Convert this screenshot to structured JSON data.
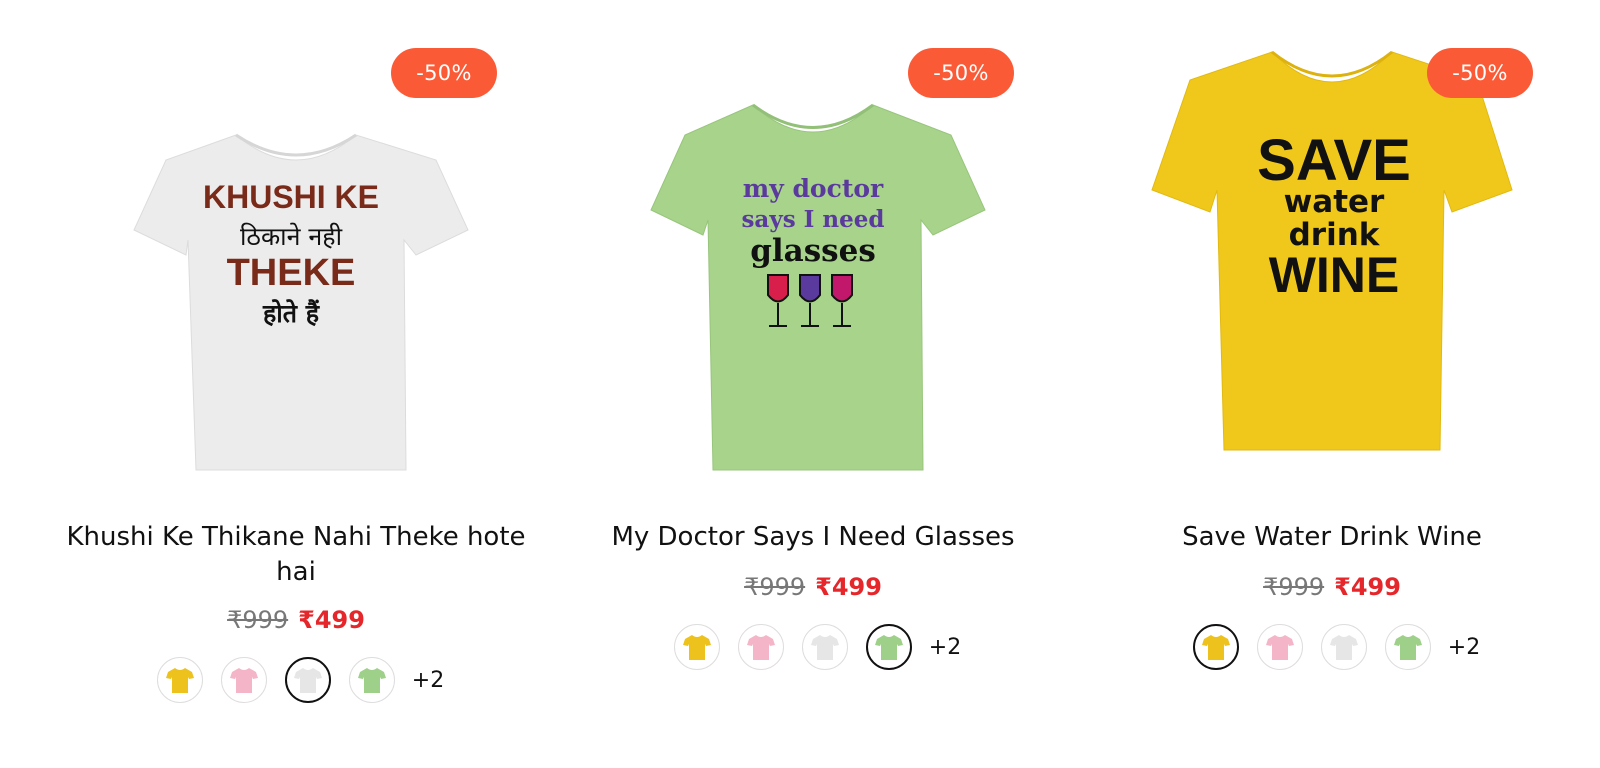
{
  "products": [
    {
      "title": "Khushi Ke Thikane Nahi Theke hote hai",
      "badge": "-50%",
      "old_price": "₹999",
      "new_price": "₹499",
      "shirt_color": "#ececec",
      "print_lines": [
        "KHUSHI KE",
        "ठिकाने नही",
        "THEKE",
        "होते हैं"
      ],
      "swatches": [
        "yellow",
        "pink",
        "white",
        "green"
      ],
      "selected_swatch": "white",
      "more_colors": "+2"
    },
    {
      "title": "My Doctor Says I Need Glasses",
      "badge": "-50%",
      "old_price": "₹999",
      "new_price": "₹499",
      "shirt_color": "#a7d38b",
      "print_lines": [
        "my doctor",
        "says I need",
        "glasses"
      ],
      "swatches": [
        "yellow",
        "pink",
        "white",
        "green"
      ],
      "selected_swatch": "green",
      "more_colors": "+2"
    },
    {
      "title": "Save Water Drink Wine",
      "badge": "-50%",
      "old_price": "₹999",
      "new_price": "₹499",
      "shirt_color": "#f0c81c",
      "print_lines": [
        "SAVE",
        "water",
        "drink",
        "WINE"
      ],
      "swatches": [
        "yellow",
        "pink",
        "white",
        "green"
      ],
      "selected_swatch": "yellow",
      "more_colors": "+2"
    }
  ],
  "swatch_colors": {
    "yellow": "#eec21c",
    "pink": "#f5b5c8",
    "white": "#e6e6e6",
    "green": "#9fd08a"
  }
}
